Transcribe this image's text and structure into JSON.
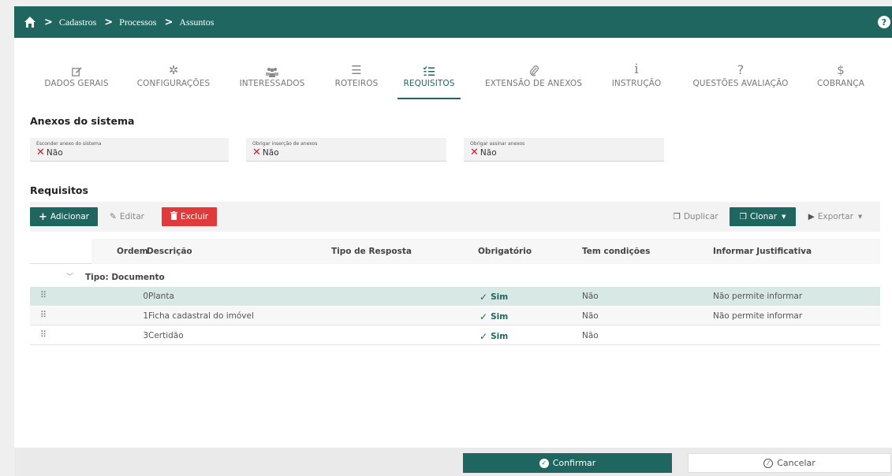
{
  "breadcrumb": [
    "Cadastros",
    "Processos",
    "Assuntos"
  ],
  "help_label": "?",
  "tabs": [
    {
      "label": "DADOS GERAIS",
      "icon": "edit-icon"
    },
    {
      "label": "CONFIGURAÇÕES",
      "icon": "cogs-icon"
    },
    {
      "label": "INTERESSADOS",
      "icon": "users-icon"
    },
    {
      "label": "ROTEIROS",
      "icon": "list-icon"
    },
    {
      "label": "REQUISITOS",
      "icon": "ordered-list-icon",
      "active": true
    },
    {
      "label": "EXTENSÃO DE ANEXOS",
      "icon": "paperclip-icon"
    },
    {
      "label": "INSTRUÇÃO",
      "icon": "info-icon"
    },
    {
      "label": "QUESTÕES AVALIAÇÃO",
      "icon": "question-icon"
    },
    {
      "label": "COBRANÇA",
      "icon": "dollar-icon"
    }
  ],
  "anexos": {
    "title": "Anexos do sistema",
    "fields": [
      {
        "label": "Esconder anexo do sistema",
        "value": "Não"
      },
      {
        "label": "Obrigar inserção de anexos",
        "value": "Não"
      },
      {
        "label": "Obrigar assinar anexos",
        "value": "Não"
      }
    ]
  },
  "requisitos": {
    "title": "Requisitos",
    "toolbar": {
      "add": "Adicionar",
      "edit": "Editar",
      "delete": "Excluir",
      "duplicate": "Duplicar",
      "clone": "Clonar",
      "export": "Exportar"
    },
    "columns": [
      "Ordem",
      "Descrição",
      "Tipo de Resposta",
      "Obrigatório",
      "Tem condições",
      "Informar Justificativa"
    ],
    "group_label": "Tipo: Documento",
    "rows": [
      {
        "ordem": "0",
        "descricao": "Planta",
        "tipo": "",
        "obrigatorio": "Sim",
        "condicoes": "Não",
        "justificativa": "Não permite informar"
      },
      {
        "ordem": "1",
        "descricao": "Ficha cadastral do imóvel",
        "tipo": "",
        "obrigatorio": "Sim",
        "condicoes": "Não",
        "justificativa": "Não permite informar"
      },
      {
        "ordem": "3",
        "descricao": "Certidão",
        "tipo": "",
        "obrigatorio": "Sim",
        "condicoes": "Não",
        "justificativa": ""
      }
    ]
  },
  "footer": {
    "confirm": "Confirmar",
    "cancel": "Cancelar"
  },
  "colors": {
    "primary": "#1f6660",
    "danger": "#e03a3a",
    "selected_row": "#d7e8e5"
  }
}
